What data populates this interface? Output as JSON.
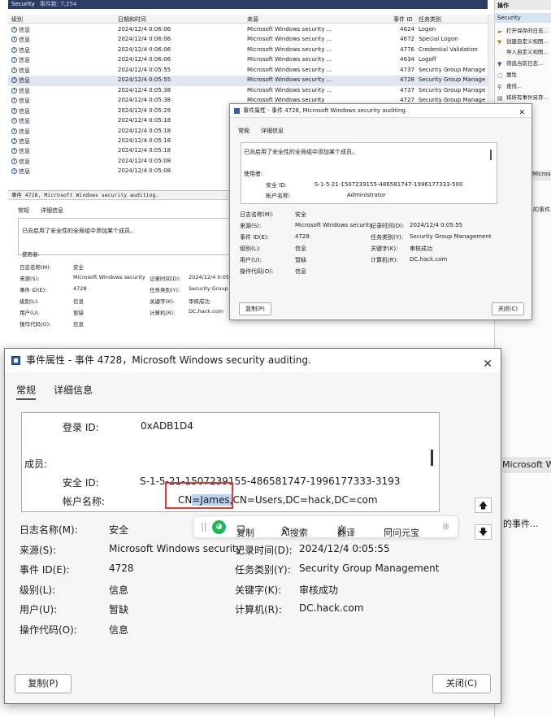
{
  "viewer": {
    "title": "Security",
    "event_count": "事件数: 7,254",
    "columns": [
      "级别",
      "日期和时间",
      "来源",
      "事件 ID",
      "任务类别"
    ],
    "rows": [
      {
        "level": "信息",
        "date": "2024/12/4 0:06:06",
        "source": "Microsoft Windows security ...",
        "id": "4624",
        "task": "Logon"
      },
      {
        "level": "信息",
        "date": "2024/12/4 0:06:06",
        "source": "Microsoft Windows security ...",
        "id": "4672",
        "task": "Special Logon"
      },
      {
        "level": "信息",
        "date": "2024/12/4 0:06:06",
        "source": "Microsoft Windows security ...",
        "id": "4776",
        "task": "Credential Validation"
      },
      {
        "level": "信息",
        "date": "2024/12/4 0:06:06",
        "source": "Microsoft Windows security ...",
        "id": "4634",
        "task": "Logoff"
      },
      {
        "level": "信息",
        "date": "2024/12/4 0:05:55",
        "source": "Microsoft Windows security ...",
        "id": "4737",
        "task": "Security Group Manage"
      },
      {
        "level": "信息",
        "date": "2024/12/4 0:05:55",
        "source": "Microsoft Windows security ...",
        "id": "4728",
        "task": "Security Group Manage"
      },
      {
        "level": "信息",
        "date": "2024/12/4 0:05:38",
        "source": "Microsoft Windows security ...",
        "id": "4737",
        "task": "Security Group Manage"
      },
      {
        "level": "信息",
        "date": "2024/12/4 0:05:38",
        "source": "Microsoft Windows security",
        "id": "4727",
        "task": "Security Group Manage"
      },
      {
        "level": "信息",
        "date": "2024/12/4 0:05:29",
        "source": "",
        "id": "",
        "task": ""
      },
      {
        "level": "信息",
        "date": "2024/12/4 0:05:18",
        "source": "",
        "id": "",
        "task": ""
      },
      {
        "level": "信息",
        "date": "2024/12/4 0:05:18",
        "source": "",
        "id": "",
        "task": ""
      },
      {
        "level": "信息",
        "date": "2024/12/4 0:05:18",
        "source": "",
        "id": "",
        "task": ""
      },
      {
        "level": "信息",
        "date": "2024/12/4 0:05:18",
        "source": "",
        "id": "",
        "task": ""
      },
      {
        "level": "信息",
        "date": "2024/12/4 0:05:08",
        "source": "",
        "id": "",
        "task": ""
      },
      {
        "level": "信息",
        "date": "2024/12/4 0:05:08",
        "source": "",
        "id": "",
        "task": ""
      }
    ],
    "detail_title": "事件 4728, Microsoft Windows security auditing.",
    "detail_tabs": [
      "常规",
      "详细信息"
    ],
    "detail_desc": "已向启用了安全性的全局组中添加某个成员。",
    "detail_desc_partial": "使用者:",
    "detail_props": [
      {
        "label": "日志名称(M):",
        "value": "安全"
      },
      {
        "label": "来源(S):",
        "value": "Microsoft Windows security"
      },
      {
        "label": "事件 ID(E):",
        "value": "4728"
      },
      {
        "label": "级别(L):",
        "value": "信息"
      },
      {
        "label": "用户(U):",
        "value": "暂缺"
      },
      {
        "label": "操作代码(O):",
        "value": "信息"
      }
    ],
    "detail_props_right": [
      {
        "label": "记录时间(D):",
        "value": "2024/12/4 0:05"
      },
      {
        "label": "任务类别(Y):",
        "value": "Security Group"
      },
      {
        "label": "关键字(K):",
        "value": "审核成功"
      },
      {
        "label": "计算机(R):",
        "value": "DC.hack.com"
      }
    ]
  },
  "actions": {
    "title": "操作",
    "section": "Security",
    "items": [
      "打开保存的日志...",
      "创建自定义视图...",
      "导入自定义视图...",
      "筛选当前日志...",
      "属性",
      "查找...",
      "将所有事件另存..."
    ],
    "side_texts": [
      "Microso",
      "的事件...",
      "Microsoft W",
      "的事件..."
    ]
  },
  "dialog_small": {
    "title": "事件属性 - 事件 4728, Microsoft Windows security auditing.",
    "tabs": [
      "常规",
      "详细信息"
    ],
    "desc": "已向启用了安全性的全局组中添加某个成员。",
    "subject_label": "使用者:",
    "sid_label": "安全 ID:",
    "sid_value": "S-1-5-21-1507239155-486581747-1996177333-500",
    "account_label": "帐户名称:",
    "account_value": "Administrator",
    "props": [
      {
        "label": "日志名称(M):",
        "value": "安全"
      },
      {
        "label": "来源(S):",
        "value": "Microsoft Windows security"
      },
      {
        "label": "事件 ID(E):",
        "value": "4728"
      },
      {
        "label": "级别(L):",
        "value": "信息"
      },
      {
        "label": "用户(U):",
        "value": "暂缺"
      },
      {
        "label": "操作代码(O):",
        "value": "信息"
      }
    ],
    "props_right": [
      {
        "label": "记录时间(D):",
        "value": "2024/12/4 0:05:55"
      },
      {
        "label": "任务类别(Y):",
        "value": "Security Group Management"
      },
      {
        "label": "关键字(K):",
        "value": "审核成功"
      },
      {
        "label": "计算机(R):",
        "value": "DC.hack.com"
      }
    ],
    "copy_button": "复制(P)",
    "close_button": "关闭(C)"
  },
  "dialog_large": {
    "title": "事件属性 - 事件 4728，Microsoft Windows security auditing.",
    "tabs": [
      "常规",
      "详细信息"
    ],
    "logon_id_label": "登录 ID:",
    "logon_id_value": "0xADB1D4",
    "member_label": "成员:",
    "sid_label": "安全 ID:",
    "sid_value": "S-1-5-21-1507239155-486581747-1996177333-3193",
    "account_label": "帐户名称:",
    "account_prefix": "CN",
    "account_selected": "=James,",
    "account_suffix": "CN=Users,DC=hack,DC=com",
    "props": [
      {
        "label": "日志名称(M):",
        "value": "安全"
      },
      {
        "label": "来源(S):",
        "value": "Microsoft Windows security"
      },
      {
        "label": "事件 ID(E):",
        "value": "4728"
      },
      {
        "label": "级别(L):",
        "value": "信息"
      },
      {
        "label": "用户(U):",
        "value": "暂缺"
      },
      {
        "label": "操作代码(O):",
        "value": "信息"
      }
    ],
    "props_right": [
      {
        "label": "记录时间(D):",
        "value": "2024/12/4 0:05:55"
      },
      {
        "label": "任务类别(Y):",
        "value": "Security Group Management"
      },
      {
        "label": "关键字(K):",
        "value": "审核成功"
      },
      {
        "label": "计算机(R):",
        "value": "DC.hack.com"
      }
    ],
    "copy_button": "复制(P)",
    "close_button": "关闭(C)"
  },
  "selection_toolbar": {
    "copy": "复制",
    "ai_search": "AI搜索",
    "translate": "翻译",
    "ask": "问问元宝"
  },
  "colors": {
    "highlight_box": "#e53935",
    "selection": "#b9d3f0",
    "header_bar": "#2d3e66"
  }
}
